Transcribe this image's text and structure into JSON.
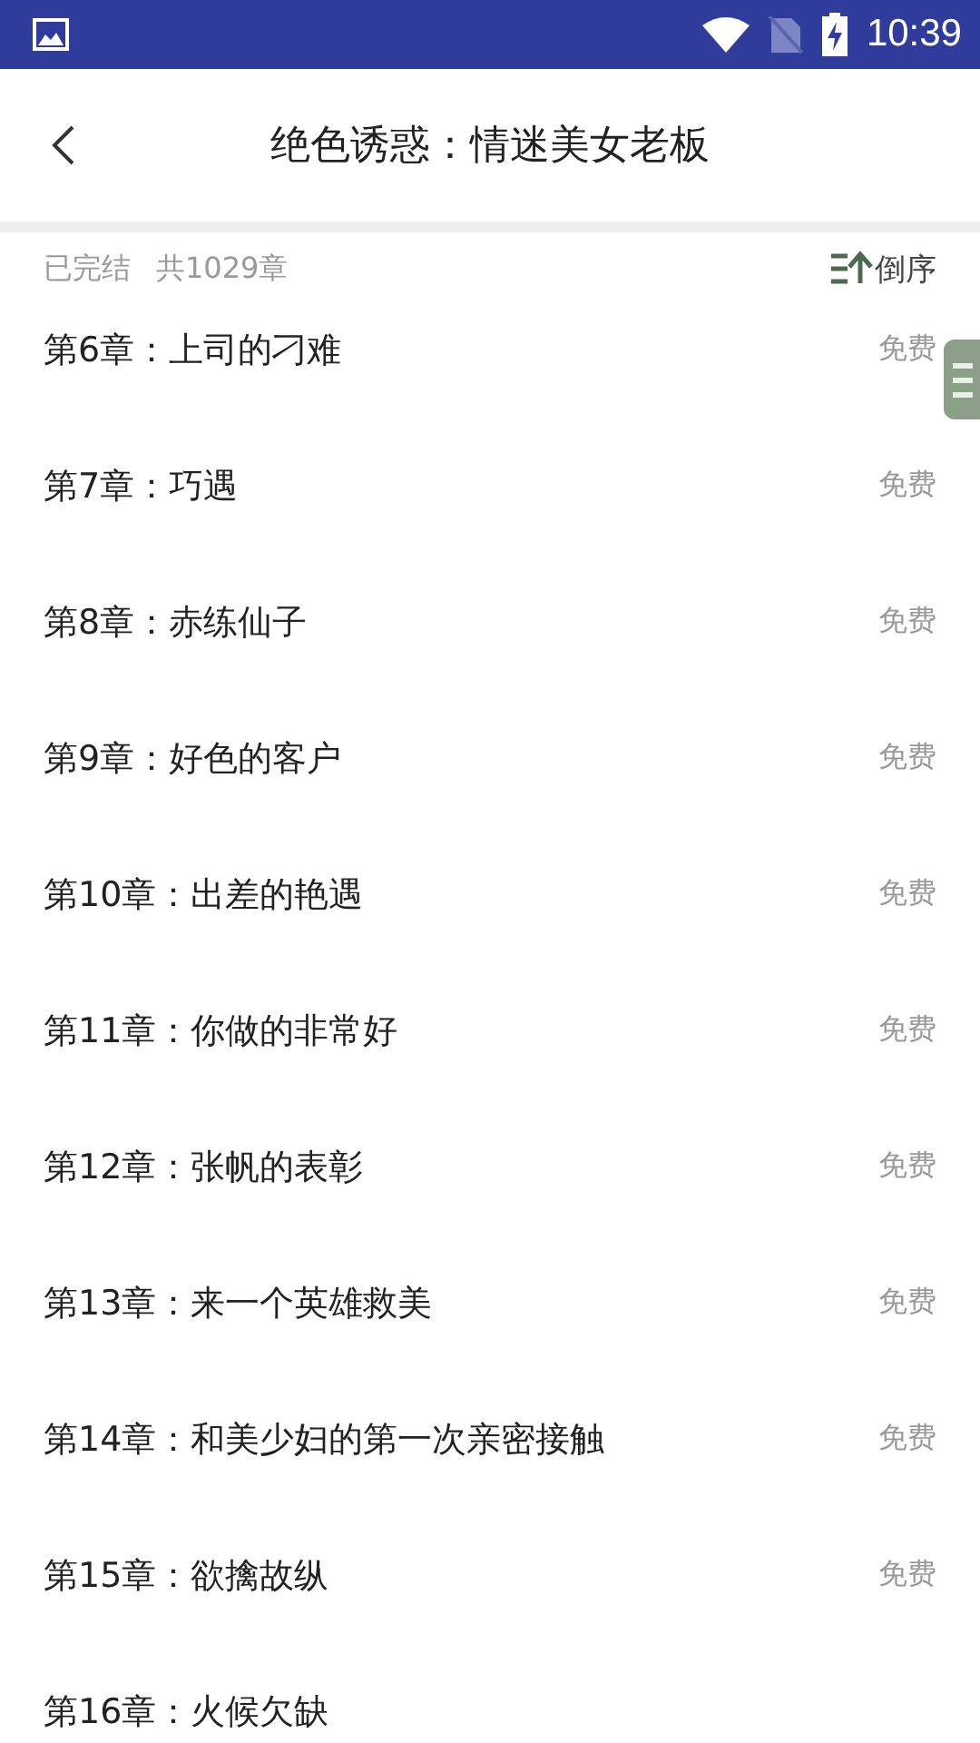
{
  "status_bar": {
    "time": "10:39"
  },
  "toolbar": {
    "title": "绝色诱惑：情迷美女老板"
  },
  "summary": {
    "status": "已完结",
    "count": "共1029章",
    "sort_label": "倒序"
  },
  "chapters": [
    {
      "title": "第6章：上司的刁难",
      "price": "免费"
    },
    {
      "title": "第7章：巧遇",
      "price": "免费"
    },
    {
      "title": "第8章：赤练仙子",
      "price": "免费"
    },
    {
      "title": "第9章：好色的客户",
      "price": "免费"
    },
    {
      "title": "第10章：出差的艳遇",
      "price": "免费"
    },
    {
      "title": "第11章：你做的非常好",
      "price": "免费"
    },
    {
      "title": "第12章：张帆的表彰",
      "price": "免费"
    },
    {
      "title": "第13章：来一个英雄救美",
      "price": "免费"
    },
    {
      "title": "第14章：和美少妇的第一次亲密接触",
      "price": "免费"
    },
    {
      "title": "第15章：欲擒故纵",
      "price": "免费"
    },
    {
      "title": "第16章：火候欠缺"
    }
  ]
}
